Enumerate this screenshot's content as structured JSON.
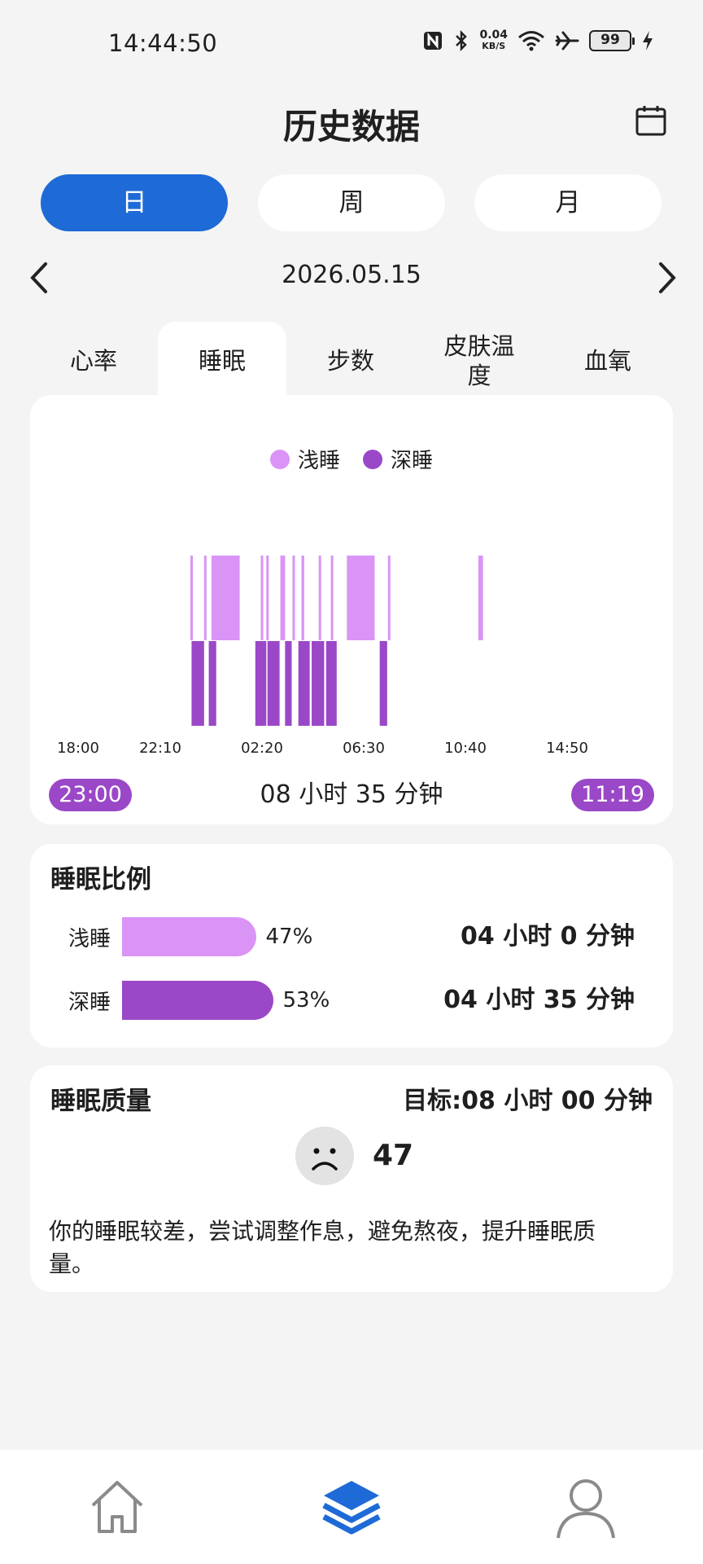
{
  "status_bar": {
    "time": "14:44:50",
    "net_speed_value": "0.04",
    "net_speed_unit": "KB/S",
    "battery": "99",
    "icons": [
      "nfc-icon",
      "bluetooth-icon",
      "wifi-icon",
      "airplane-icon",
      "battery-icon",
      "charging-icon"
    ]
  },
  "header": {
    "title": "历史数据",
    "calendar_icon": "calendar-icon"
  },
  "period_tabs": [
    {
      "label": "日",
      "active": true
    },
    {
      "label": "周",
      "active": false
    },
    {
      "label": "月",
      "active": false
    }
  ],
  "date_nav": {
    "date": "2026.05.15"
  },
  "metric_tabs": [
    {
      "label": "心率",
      "active": false
    },
    {
      "label": "睡眠",
      "active": true
    },
    {
      "label": "步数",
      "active": false
    },
    {
      "label": "皮肤温度",
      "active": false
    },
    {
      "label": "血氧",
      "active": false
    }
  ],
  "sleep_chart": {
    "legend": [
      {
        "label": "浅睡",
        "color": "#d994f6"
      },
      {
        "label": "深睡",
        "color": "#9a48c7"
      }
    ],
    "ticks": [
      "18:00",
      "22:10",
      "02:20",
      "06:30",
      "10:40",
      "14:50"
    ],
    "start_time": "23:00",
    "end_time": "11:19",
    "total_duration": "08 小时 35 分钟"
  },
  "chart_data": {
    "type": "bar",
    "title": "",
    "xlabel": "",
    "ylabel": "",
    "x_range": [
      "18:00",
      "14:50"
    ],
    "series": [
      {
        "name": "浅睡",
        "color": "#d994f6",
        "intervals": [
          [
            "22:47",
            "22:50"
          ],
          [
            "23:22",
            "23:26"
          ],
          [
            "23:41",
            "00:53"
          ],
          [
            "01:47",
            "01:51"
          ],
          [
            "02:01",
            "02:04"
          ],
          [
            "02:37",
            "02:49"
          ],
          [
            "03:08",
            "03:14"
          ],
          [
            "03:31",
            "03:38"
          ],
          [
            "04:15",
            "04:20"
          ],
          [
            "04:46",
            "04:52"
          ],
          [
            "05:27",
            "06:38"
          ],
          [
            "07:12",
            "07:17"
          ],
          [
            "11:03",
            "11:15"
          ]
        ]
      },
      {
        "name": "深睡",
        "color": "#9a48c7",
        "intervals": [
          [
            "22:50",
            "23:22"
          ],
          [
            "23:34",
            "23:53"
          ],
          [
            "01:33",
            "02:01"
          ],
          [
            "02:04",
            "02:35"
          ],
          [
            "02:49",
            "03:06"
          ],
          [
            "03:23",
            "03:52"
          ],
          [
            "03:57",
            "04:29"
          ],
          [
            "04:34",
            "05:01"
          ],
          [
            "06:51",
            "07:10"
          ]
        ]
      }
    ]
  },
  "sleep_ratio": {
    "title": "睡眠比例",
    "rows": [
      {
        "label": "浅睡",
        "percent": "47%",
        "fraction": 0.47,
        "duration": "04 小时 0 分钟",
        "color": "#d994f6"
      },
      {
        "label": "深睡",
        "percent": "53%",
        "fraction": 0.53,
        "duration": "04 小时 35 分钟",
        "color": "#9a48c7"
      }
    ]
  },
  "sleep_quality": {
    "title": "睡眠质量",
    "goal": "目标:08 小时 00 分钟",
    "score": "47",
    "face_icon": "sad-face-icon",
    "advice": "你的睡眠较差，尝试调整作息，避免熬夜，提升睡眠质量。"
  },
  "bottom_nav": [
    {
      "icon": "home-icon",
      "active": false
    },
    {
      "icon": "layers-icon",
      "active": true
    },
    {
      "icon": "profile-icon",
      "active": false
    }
  ]
}
